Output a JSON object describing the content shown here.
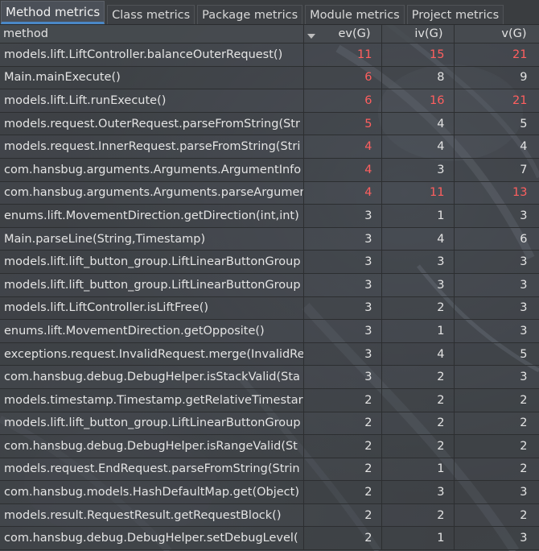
{
  "tabs": [
    {
      "label": "Method metrics",
      "active": true
    },
    {
      "label": "Class metrics",
      "active": false
    },
    {
      "label": "Package metrics",
      "active": false
    },
    {
      "label": "Module metrics",
      "active": false
    },
    {
      "label": "Project metrics",
      "active": false
    }
  ],
  "table": {
    "headers": {
      "method": "method",
      "ev": "ev(G)",
      "iv": "iv(G)",
      "v": "v(G)"
    },
    "sort_column": "ev(G)",
    "sort_direction": "descending",
    "highlight_color": "#ff5f5f",
    "rows": [
      {
        "method": "models.lift.LiftController.balanceOuterRequest()",
        "ev": "11",
        "iv": "15",
        "v": "21",
        "ev_red": true,
        "iv_red": true,
        "v_red": true
      },
      {
        "method": "Main.mainExecute()",
        "ev": "6",
        "iv": "8",
        "v": "9",
        "ev_red": true,
        "iv_red": false,
        "v_red": false
      },
      {
        "method": "models.lift.Lift.runExecute()",
        "ev": "6",
        "iv": "16",
        "v": "21",
        "ev_red": true,
        "iv_red": true,
        "v_red": true
      },
      {
        "method": "models.request.OuterRequest.parseFromString(Str",
        "ev": "5",
        "iv": "4",
        "v": "5",
        "ev_red": true,
        "iv_red": false,
        "v_red": false
      },
      {
        "method": "models.request.InnerRequest.parseFromString(Stri",
        "ev": "4",
        "iv": "4",
        "v": "4",
        "ev_red": true,
        "iv_red": false,
        "v_red": false
      },
      {
        "method": "com.hansbug.arguments.Arguments.ArgumentInfo",
        "ev": "4",
        "iv": "3",
        "v": "7",
        "ev_red": true,
        "iv_red": false,
        "v_red": false
      },
      {
        "method": "com.hansbug.arguments.Arguments.parseArgumen",
        "ev": "4",
        "iv": "11",
        "v": "13",
        "ev_red": true,
        "iv_red": true,
        "v_red": true
      },
      {
        "method": "enums.lift.MovementDirection.getDirection(int,int)",
        "ev": "3",
        "iv": "1",
        "v": "3",
        "ev_red": false,
        "iv_red": false,
        "v_red": false
      },
      {
        "method": "Main.parseLine(String,Timestamp)",
        "ev": "3",
        "iv": "4",
        "v": "6",
        "ev_red": false,
        "iv_red": false,
        "v_red": false
      },
      {
        "method": "models.lift.lift_button_group.LiftLinearButtonGroup",
        "ev": "3",
        "iv": "3",
        "v": "3",
        "ev_red": false,
        "iv_red": false,
        "v_red": false
      },
      {
        "method": "models.lift.lift_button_group.LiftLinearButtonGroup",
        "ev": "3",
        "iv": "3",
        "v": "3",
        "ev_red": false,
        "iv_red": false,
        "v_red": false
      },
      {
        "method": "models.lift.LiftController.isLiftFree()",
        "ev": "3",
        "iv": "2",
        "v": "3",
        "ev_red": false,
        "iv_red": false,
        "v_red": false
      },
      {
        "method": "enums.lift.MovementDirection.getOpposite()",
        "ev": "3",
        "iv": "1",
        "v": "3",
        "ev_red": false,
        "iv_red": false,
        "v_red": false
      },
      {
        "method": "exceptions.request.InvalidRequest.merge(InvalidRe",
        "ev": "3",
        "iv": "4",
        "v": "5",
        "ev_red": false,
        "iv_red": false,
        "v_red": false
      },
      {
        "method": "com.hansbug.debug.DebugHelper.isStackValid(Sta",
        "ev": "3",
        "iv": "2",
        "v": "3",
        "ev_red": false,
        "iv_red": false,
        "v_red": false
      },
      {
        "method": "models.timestamp.Timestamp.getRelativeTimestar",
        "ev": "2",
        "iv": "2",
        "v": "2",
        "ev_red": false,
        "iv_red": false,
        "v_red": false
      },
      {
        "method": "models.lift.lift_button_group.LiftLinearButtonGroup",
        "ev": "2",
        "iv": "2",
        "v": "2",
        "ev_red": false,
        "iv_red": false,
        "v_red": false
      },
      {
        "method": "com.hansbug.debug.DebugHelper.isRangeValid(St",
        "ev": "2",
        "iv": "2",
        "v": "2",
        "ev_red": false,
        "iv_red": false,
        "v_red": false
      },
      {
        "method": "models.request.EndRequest.parseFromString(Strin",
        "ev": "2",
        "iv": "1",
        "v": "2",
        "ev_red": false,
        "iv_red": false,
        "v_red": false
      },
      {
        "method": "com.hansbug.models.HashDefaultMap.get(Object)",
        "ev": "2",
        "iv": "3",
        "v": "3",
        "ev_red": false,
        "iv_red": false,
        "v_red": false
      },
      {
        "method": "models.result.RequestResult.getRequestBlock()",
        "ev": "2",
        "iv": "2",
        "v": "2",
        "ev_red": false,
        "iv_red": false,
        "v_red": false
      },
      {
        "method": "com.hansbug.debug.DebugHelper.setDebugLevel(",
        "ev": "2",
        "iv": "1",
        "v": "3",
        "ev_red": false,
        "iv_red": false,
        "v_red": false
      }
    ]
  }
}
